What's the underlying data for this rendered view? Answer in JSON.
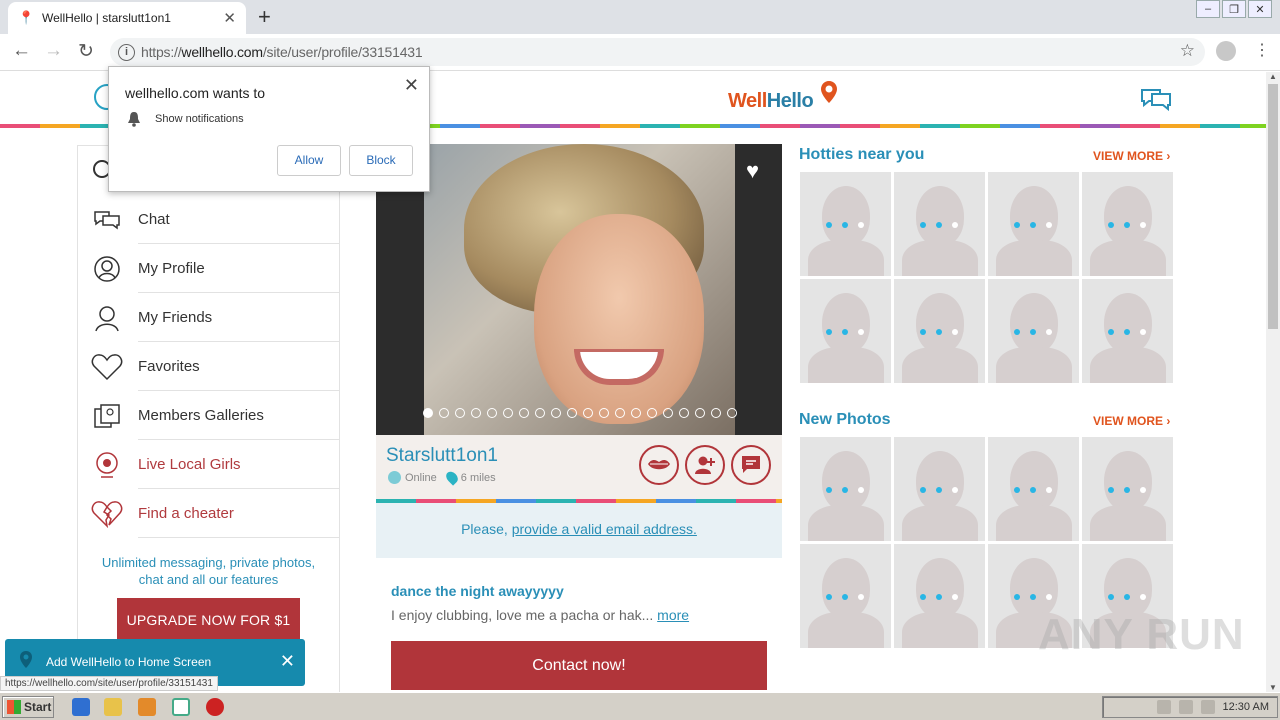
{
  "browser": {
    "tab_title": "WellHello | starslutt1on1",
    "url_prefix": "https://",
    "url_host": "wellhello.com",
    "url_path": "/site/user/profile/33151431"
  },
  "site": {
    "logo_part1": "Well",
    "logo_part2": "Hello"
  },
  "sidebar": {
    "items": [
      {
        "label": "Chat"
      },
      {
        "label": "My Profile"
      },
      {
        "label": "My Friends"
      },
      {
        "label": "Favorites"
      },
      {
        "label": "Members Galleries"
      },
      {
        "label": "Live Local Girls"
      },
      {
        "label": "Find a cheater"
      }
    ],
    "promo": "Unlimited messaging, private photos, chat and all our features",
    "upgrade": "UPGRADE NOW FOR $1"
  },
  "profile": {
    "name": "Starslutt1on1",
    "online": "Online",
    "distance": "6 miles",
    "email_prefix": "Please, ",
    "email_link": "provide a valid email address.",
    "headline": "dance the night awayyyyy",
    "bio": "I enjoy clubbing, love me a pacha or hak...",
    "more": "more",
    "contact": "Contact now!",
    "photo_count": 20,
    "active_photo": 1
  },
  "right": {
    "hotties_title": "Hotties near you",
    "new_photos_title": "New Photos",
    "view_more": "VIEW MORE ›"
  },
  "notification": {
    "title": "wellhello.com wants to",
    "text": "Show notifications",
    "allow": "Allow",
    "block": "Block"
  },
  "a2hs": {
    "text": "Add WellHello to Home Screen"
  },
  "status_url": "https://wellhello.com/site/user/profile/33151431",
  "watermark": "ANY RUN",
  "taskbar": {
    "start": "Start",
    "clock": "12:30 AM"
  },
  "colors": {
    "accent_teal": "#2a8fb7",
    "accent_red": "#b1353a",
    "accent_orange": "#e0541e"
  }
}
